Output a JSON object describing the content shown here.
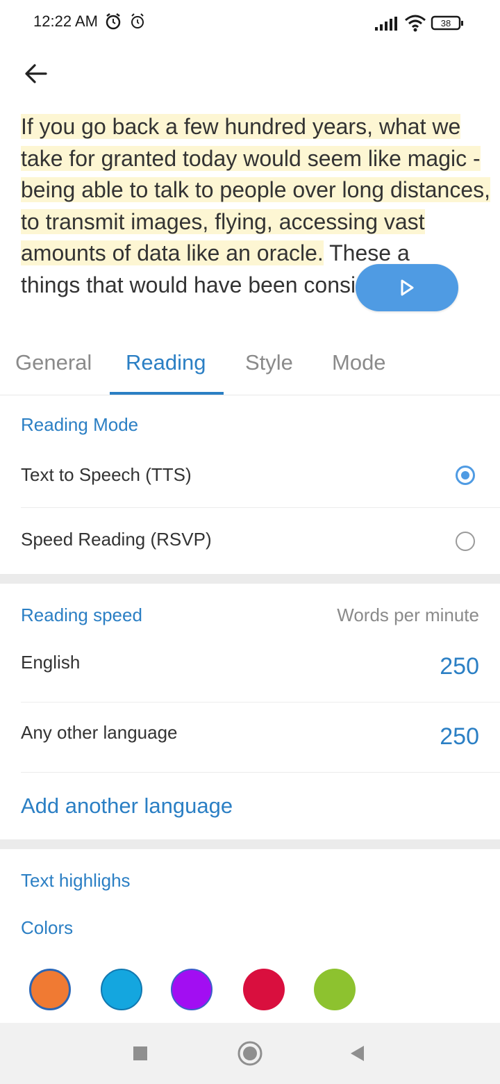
{
  "status_bar": {
    "time": "12:22 AM",
    "battery": "38",
    "icons": [
      "alarm-icon",
      "alarm-clock-icon",
      "signal-icon",
      "wifi-icon",
      "battery-icon"
    ]
  },
  "toolbar": {
    "back_icon": "arrow-left-icon"
  },
  "preview": {
    "highlighted_text": "If you go back a few hundred years, what we take for granted today would seem like magic - being able to talk to people over long distances, to transmit images, flying, accessing vast amounts of data like an oracle.",
    "rest_text": " These a",
    "tail_text": "things that would have been considered",
    "play_icon": "play-icon"
  },
  "tabs": [
    {
      "label": "General"
    },
    {
      "label": "Reading"
    },
    {
      "label": "Style"
    },
    {
      "label": "Mode"
    }
  ],
  "active_tab": "Reading",
  "reading_mode": {
    "title": "Reading Mode",
    "options": [
      {
        "label": "Text to Speech (TTS)",
        "selected": true
      },
      {
        "label": "Speed Reading (RSVP)",
        "selected": false
      }
    ]
  },
  "reading_speed": {
    "title": "Reading speed",
    "unit_label": "Words per minute",
    "rows": [
      {
        "label": "English",
        "value": "250"
      },
      {
        "label": "Any other language",
        "value": "250"
      }
    ],
    "add_language_label": "Add another language"
  },
  "text_highlights": {
    "title": "Text highlighs",
    "colors_label": "Colors",
    "swatches": [
      "#f07a33",
      "#14a6df",
      "#a20ef2",
      "#d90f3e",
      "#8dc22f"
    ],
    "selected_index": 0
  },
  "nav_bar": {
    "icons": [
      "recents-square-icon",
      "home-circle-icon",
      "back-triangle-icon"
    ]
  }
}
